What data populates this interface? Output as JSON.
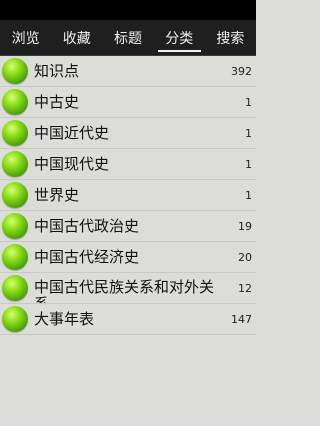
{
  "tabs": [
    {
      "label": "浏览"
    },
    {
      "label": "收藏"
    },
    {
      "label": "标题"
    },
    {
      "label": "分类",
      "selected": true
    },
    {
      "label": "搜索"
    }
  ],
  "categories": [
    {
      "label": "知识点",
      "count": "392"
    },
    {
      "label": "中古史",
      "count": "1"
    },
    {
      "label": "中国近代史",
      "count": "1"
    },
    {
      "label": "中国现代史",
      "count": "1"
    },
    {
      "label": "世界史",
      "count": "1"
    },
    {
      "label": "中国古代政治史",
      "count": "19"
    },
    {
      "label": "中国古代经济史",
      "count": "20"
    },
    {
      "label": "中国古代民族关系和对外关系",
      "count": "12"
    },
    {
      "label": "大事年表",
      "count": "147"
    }
  ],
  "colors": {
    "tab_bar": "#1f1f1f",
    "list_background": "#dcdcd8",
    "icon_green": "#6cc414"
  },
  "icons": {
    "category_icon": "green-ball-icon"
  }
}
